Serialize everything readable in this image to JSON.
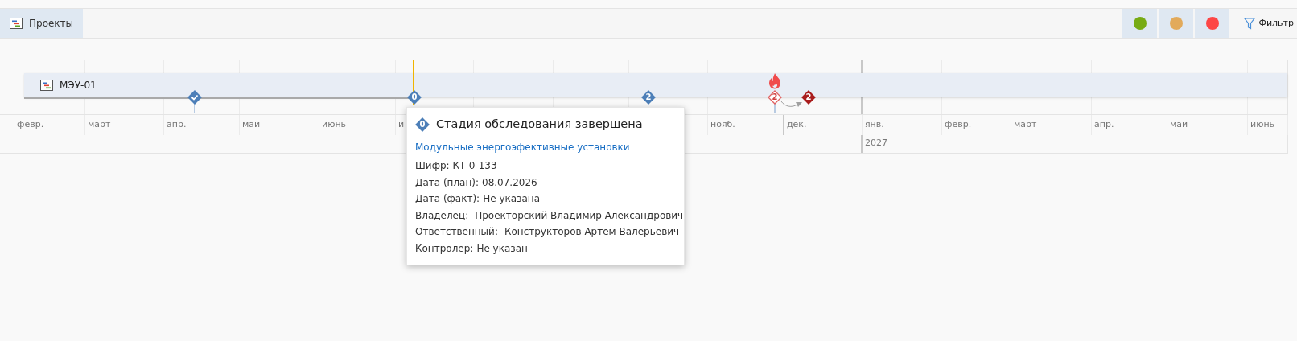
{
  "toolbar": {
    "projects_button": {
      "label": "Проекты",
      "selected": true
    },
    "status_filters": [
      {
        "color": "#77ab14"
      },
      {
        "color": "#e2aa5b"
      },
      {
        "color": "#fd4645"
      }
    ],
    "filter_button": {
      "label": "Фильтр"
    }
  },
  "timeline": {
    "months_before_tooltip": [
      "февр.",
      "март",
      "апр.",
      "май",
      "июнь",
      "и"
    ],
    "months_after_tooltip": [
      "нояб.",
      "дек.",
      "янв.",
      "февр.",
      "март",
      "апр.",
      "май",
      "июнь"
    ],
    "year": "2027",
    "project": {
      "label": "МЭУ-01"
    },
    "milestones": [
      {
        "kind": "done"
      },
      {
        "kind": "current",
        "label": "0"
      },
      {
        "kind": "normal",
        "label": "2"
      },
      {
        "kind": "warning",
        "label": "2"
      },
      {
        "kind": "overdue",
        "label": "2"
      }
    ]
  },
  "tooltip": {
    "badge": "0",
    "title": "Стадия обследования завершена",
    "link": "Модульные энергоэфективные установки",
    "fields": [
      {
        "label": "Шифр:",
        "value": "КТ-0-133"
      },
      {
        "label": "Дата (план):",
        "value": "08.07.2026"
      },
      {
        "label": "Дата (факт):",
        "value": "Не указана"
      },
      {
        "label": "Владелец:",
        "value": "Проекторский Владимир Александрович",
        "kind": "person"
      },
      {
        "label": "Ответственный:",
        "value": "Конструкторов Артем Валерьевич",
        "kind": "person"
      },
      {
        "label": "Контролер:",
        "value": "Не указан"
      }
    ]
  }
}
